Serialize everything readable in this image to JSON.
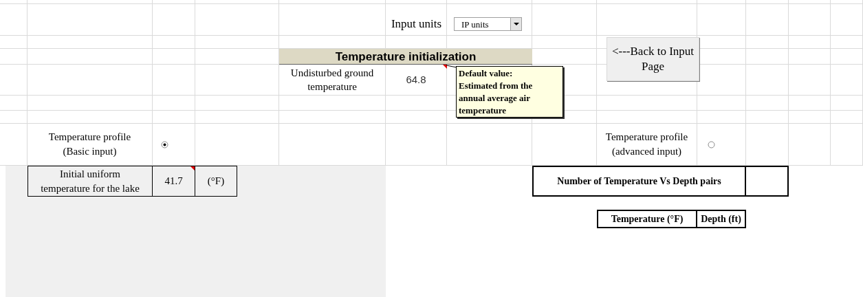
{
  "input_units": {
    "label": "Input units",
    "value": "IP units"
  },
  "back_button": {
    "label": "<---Back to Input Page"
  },
  "section": {
    "title": "Temperature initialization"
  },
  "ground_temperature": {
    "label": "Undisturbed ground temperature",
    "value": "64.8",
    "comment_marker": true
  },
  "comment": {
    "title": "Default value:",
    "text": "Estimated from the annual average air temperature"
  },
  "profiles": [
    {
      "label": "Temperature profile (Basic input)",
      "selected": true
    },
    {
      "label": "Temperature profile (advanced input)",
      "selected": false
    }
  ],
  "uniform_temperature": {
    "label": "Initial uniform temperature for the lake",
    "value": "41.7",
    "unit": "(°F)",
    "comment_marker": true
  },
  "pairs": {
    "label": "Number of Temperature Vs Depth pairs"
  },
  "pairs_table": {
    "columns": [
      "Temperature (°F)",
      "Depth (ft)"
    ]
  }
}
